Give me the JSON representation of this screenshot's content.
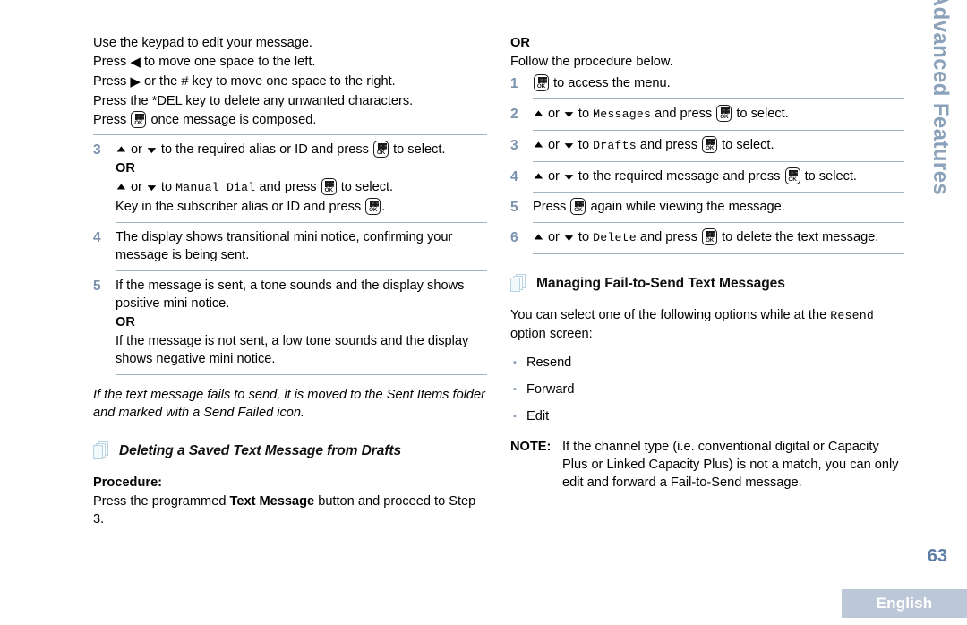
{
  "document": {
    "page_number": "63",
    "language_label": "English",
    "side_tab": "Advanced Features",
    "colors": {
      "step_number": "#7b92ac",
      "divider": "#9fb6c4",
      "side_tab": "#8ca2bb",
      "page_number": "#5c7da3",
      "language_bar_bg": "#bcc8d8",
      "bullet": "#8aa1b8",
      "heading_icon": "#b9d3e2"
    }
  },
  "left_column": {
    "intro_lines": [
      "Use the keypad to edit your message.",
      "Press ◀ to move one space to the left.",
      "Press ▶ or the # key to move one space to the right.",
      "Press the *DEL key to delete any unwanted characters.",
      "Press ⌨ once message is composed."
    ],
    "line1": "Use the keypad to edit your message.",
    "line2_pre": "Press",
    "line2_post": "to move one space to the left.",
    "line3_pre": "Press",
    "line3_post": "or the # key to move one space to the right.",
    "line4": "Press the *DEL key to delete any unwanted characters.",
    "line5_pre": "Press",
    "line5_post": "once message is composed.",
    "step3": {
      "number": "3",
      "or_label_a": "or",
      "text_a": "to the required alias or ID and press",
      "text_a_end": "to select.",
      "or_divider": "OR",
      "or_label_b": "or",
      "text_b_pre": "to",
      "menu_item": "Manual Dial",
      "text_b_mid": "and press",
      "text_b_end": "to select.",
      "text_c_pre": "Key in the subscriber alias or ID and press",
      "text_c_end": "."
    },
    "step4": {
      "number": "4",
      "text": "The display shows transitional mini notice, confirming your message is being sent."
    },
    "step5": {
      "number": "5",
      "text_a": "If the message is sent, a tone sounds and the display shows positive mini notice.",
      "or_divider": "OR",
      "text_b": "If the message is not sent, a low tone sounds and the display shows negative mini notice."
    },
    "italic_note": "If the text message fails to send, it is moved to the Sent Items folder and marked with a Send Failed icon.",
    "heading": "Deleting a Saved Text Message from Drafts",
    "procedure_label": "Procedure:",
    "procedure_pre": "Press the programmed",
    "procedure_bold": "Text Message",
    "procedure_post": "button and proceed to Step 3."
  },
  "right_column": {
    "or_label": "OR",
    "follow_line": "Follow the procedure below.",
    "step1": {
      "number": "1",
      "text": "to access the menu."
    },
    "step2": {
      "number": "2",
      "or_label": "or",
      "text_pre": "to",
      "menu_item": "Messages",
      "text_mid": "and press",
      "text_end": "to select."
    },
    "step3": {
      "number": "3",
      "or_label": "or",
      "text_pre": "to",
      "menu_item": "Drafts",
      "text_mid": "and press",
      "text_end": "to select."
    },
    "step4": {
      "number": "4",
      "or_label": "or",
      "text_pre": "to the required message and press",
      "text_end": "to select."
    },
    "step5": {
      "number": "5",
      "text_pre": "Press",
      "text_end": "again while viewing the message."
    },
    "step6": {
      "number": "6",
      "or_label": "or",
      "text_pre": "to",
      "menu_item": "Delete",
      "text_mid": "and press",
      "text_end": "to delete the text message."
    },
    "heading": "Managing Fail-to-Send Text Messages",
    "intro_pre": "You can select one of the following options while at the",
    "intro_mono": "Resend",
    "intro_post": "option screen:",
    "options": [
      "Resend",
      "Forward",
      "Edit"
    ],
    "note_label": "NOTE:",
    "note_text": "If the channel type (i.e. conventional digital or Capacity Plus or Linked Capacity Plus) is not a match, you can only edit and forward a Fail-to-Send message."
  },
  "icons": {
    "ok_key": "ok-menu-key-icon",
    "arrow_up": "▲",
    "arrow_down": "▼",
    "arrow_left": "◀",
    "arrow_right": "▶",
    "bullet": "▪",
    "ok_key_label": "OK"
  }
}
